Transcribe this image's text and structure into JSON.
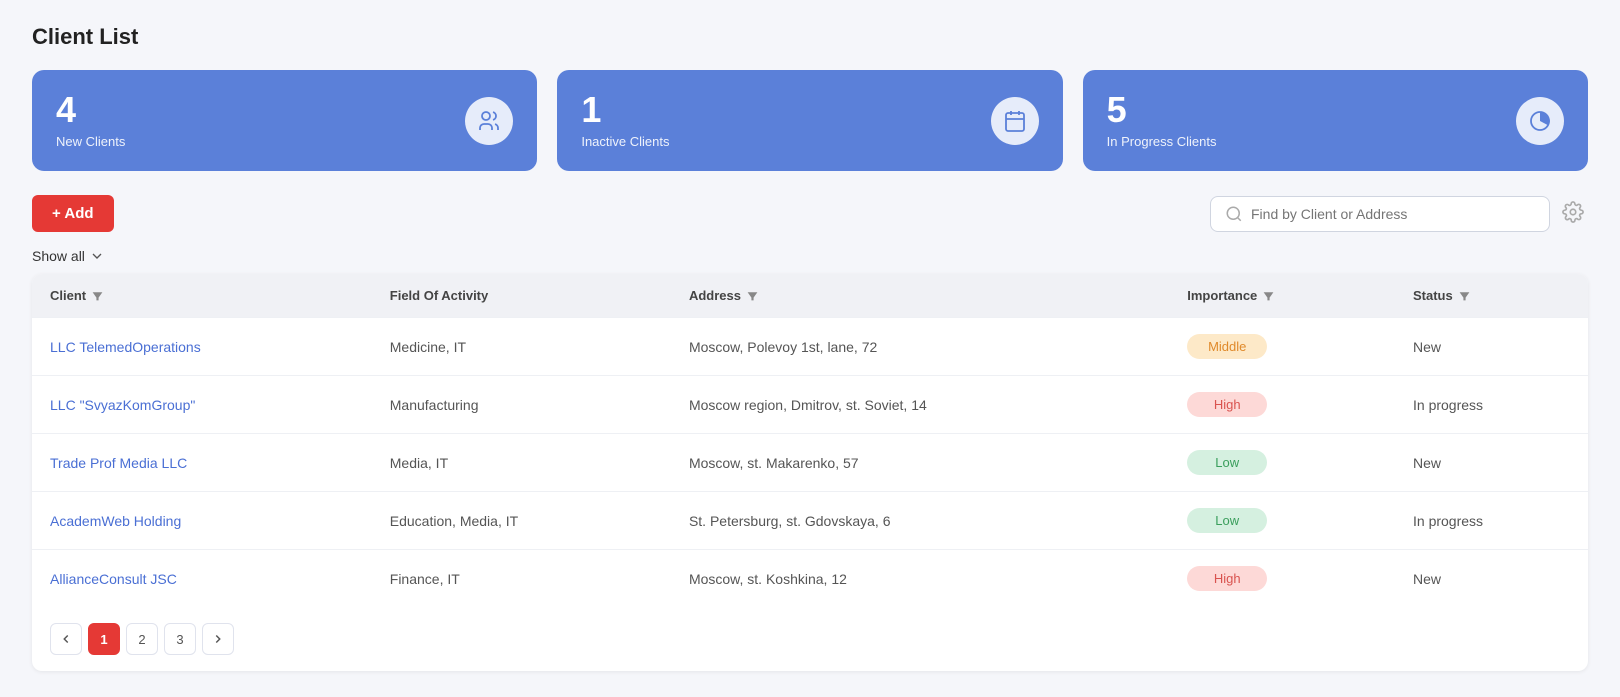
{
  "page": {
    "title": "Client List"
  },
  "stats": [
    {
      "id": "new-clients",
      "number": "4",
      "label": "New Clients",
      "icon": "users"
    },
    {
      "id": "inactive-clients",
      "number": "1",
      "label": "Inactive Clients",
      "icon": "calendar"
    },
    {
      "id": "inprogress-clients",
      "number": "5",
      "label": "In Progress Clients",
      "icon": "chart"
    }
  ],
  "toolbar": {
    "add_label": "+ Add",
    "search_placeholder": "Find by Client or Address",
    "show_all_label": "Show all"
  },
  "table": {
    "headers": [
      "Client",
      "Field Of Activity",
      "Address",
      "Importance",
      "Status"
    ],
    "rows": [
      {
        "client": "LLC TelemedOperations",
        "field": "Medicine, IT",
        "address": "Moscow, Polevoy 1st, lane, 72",
        "importance": "Middle",
        "status": "New"
      },
      {
        "client": "LLC \"SvyazKomGroup\"",
        "field": "Manufacturing",
        "address": "Moscow region, Dmitrov, st. Soviet, 14",
        "importance": "High",
        "status": "In progress"
      },
      {
        "client": "Trade Prof Media LLC",
        "field": "Media, IT",
        "address": "Moscow, st. Makarenko, 57",
        "importance": "Low",
        "status": "New"
      },
      {
        "client": "AcademWeb Holding",
        "field": "Education, Media, IT",
        "address": "St. Petersburg, st. Gdovskaya, 6",
        "importance": "Low",
        "status": "In progress"
      },
      {
        "client": "AllianceConsult JSC",
        "field": "Finance, IT",
        "address": "Moscow, st. Koshkina, 12",
        "importance": "High",
        "status": "New"
      }
    ]
  },
  "pagination": {
    "prev_label": "‹",
    "pages": [
      "1",
      "2",
      "3"
    ],
    "active_page": "1",
    "next_label": "›"
  },
  "colors": {
    "accent_blue": "#5b80d9",
    "accent_red": "#e53935"
  }
}
